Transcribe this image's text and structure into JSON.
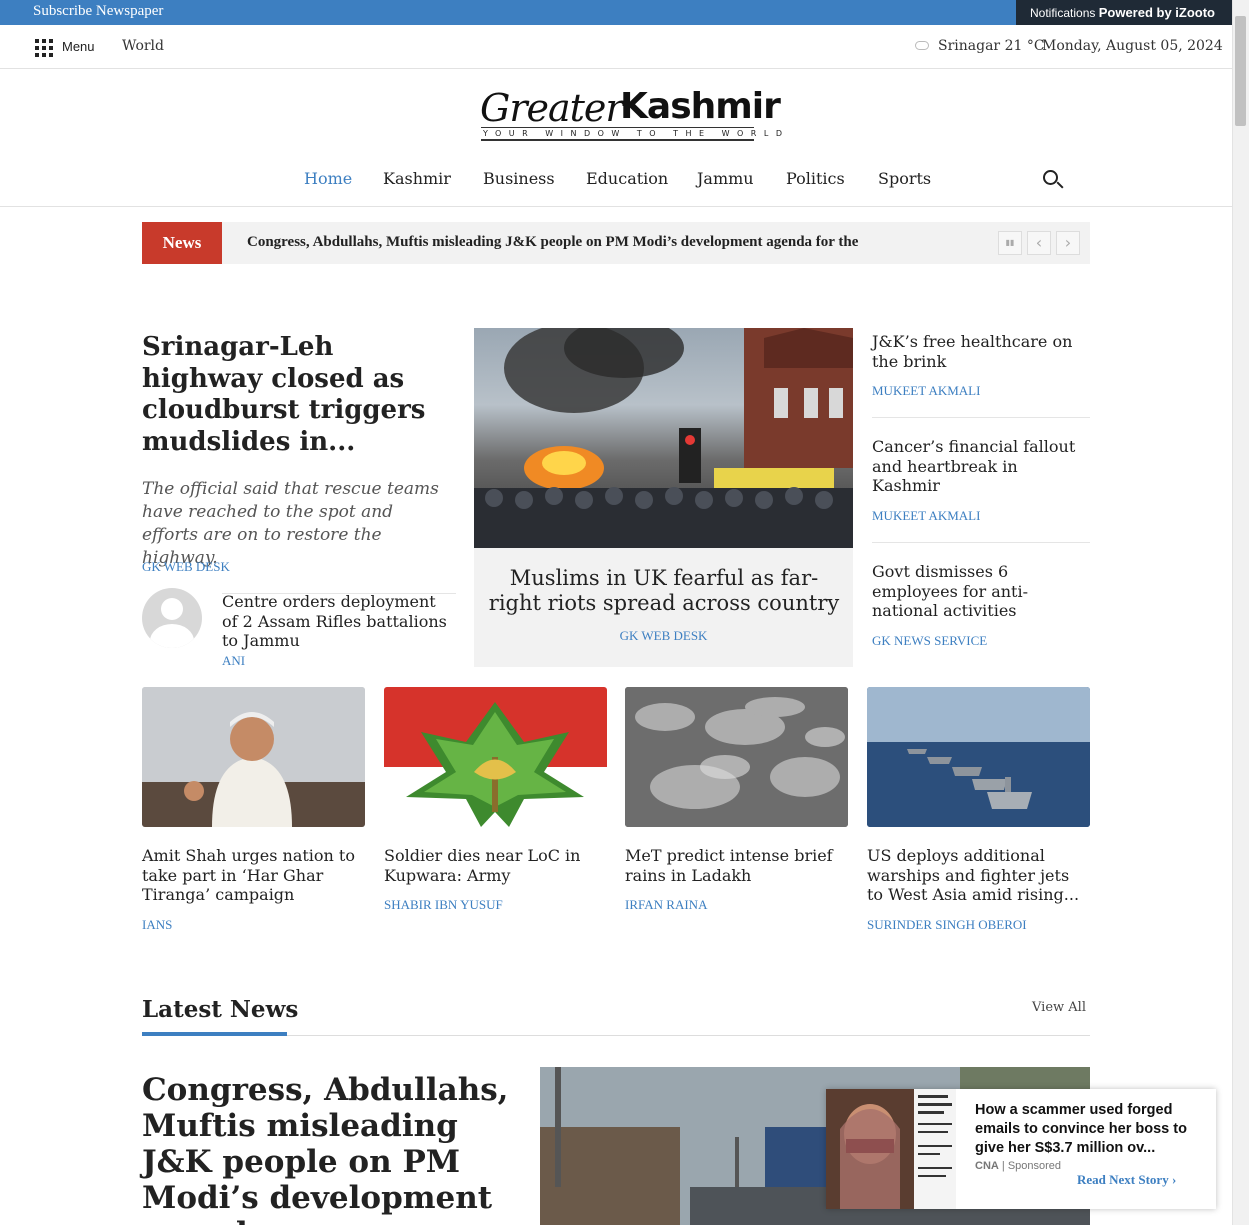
{
  "topbar": {
    "subscribe": "Subscribe Newspaper",
    "notifications": "Notifications",
    "powered": "Powered by iZooto"
  },
  "util": {
    "menu": "Menu",
    "world": "World",
    "weather": "Srinagar 21 °C",
    "date": "Monday, August 05, 2024"
  },
  "logo": {
    "part1": "Greater",
    "part2": "Kashmir",
    "tagline": "YOUR WINDOW TO THE WORLD"
  },
  "nav": [
    "Home",
    "Kashmir",
    "Business",
    "Education",
    "Jammu",
    "Politics",
    "Sports"
  ],
  "ticker": {
    "label": "News",
    "text": "Congress, Abdullahs, Muftis misleading J&K people on PM Modi’s development agenda for the",
    "pause": "▮▮",
    "prev": "‹",
    "next": "›"
  },
  "lead": {
    "title": "Srinagar-Leh highway closed as cloudburst triggers mudslides in...",
    "summary": "The official said that rescue teams have reached to the spot and efforts are on to restore the highway.",
    "author": "GK WEB DESK",
    "small": {
      "title": "Centre orders deployment of 2 Assam Rifles battalions to Jammu",
      "author": "ANI"
    }
  },
  "feature": {
    "title": "Muslims in UK fearful as far-right riots spread across country",
    "author": "GK WEB DESK"
  },
  "right": [
    {
      "title": "J&K’s free healthcare on the brink",
      "author": "MUKEET AKMALI"
    },
    {
      "title": "Cancer’s financial fallout and heartbreak in Kashmir",
      "author": "MUKEET AKMALI"
    },
    {
      "title": "Govt dismisses 6 employees for anti-national activities",
      "author": "GK NEWS SERVICE"
    }
  ],
  "cards": [
    {
      "title": "Amit Shah urges nation to take part in ‘Har Ghar Tiranga’ campaign",
      "author": "IANS"
    },
    {
      "title": "Soldier dies near LoC in Kupwara: Army",
      "author": "SHABIR IBN YUSUF"
    },
    {
      "title": "MeT predict intense brief rains in Ladakh",
      "author": "IRFAN RAINA"
    },
    {
      "title": "US deploys additional warships and fighter jets to West Asia amid rising...",
      "author": "SURINDER SINGH OBEROI"
    }
  ],
  "latest": {
    "heading": "Latest News",
    "view_all": "View All",
    "title": "Congress, Abdullahs, Muftis misleading J&K people on PM Modi’s development agenda..."
  },
  "ad": {
    "title": "How a scammer used forged emails to convince her boss to give her S$3.7 million ov...",
    "source": "CNA",
    "sponsored": " | Sponsored",
    "next": "Read Next Story ›"
  }
}
